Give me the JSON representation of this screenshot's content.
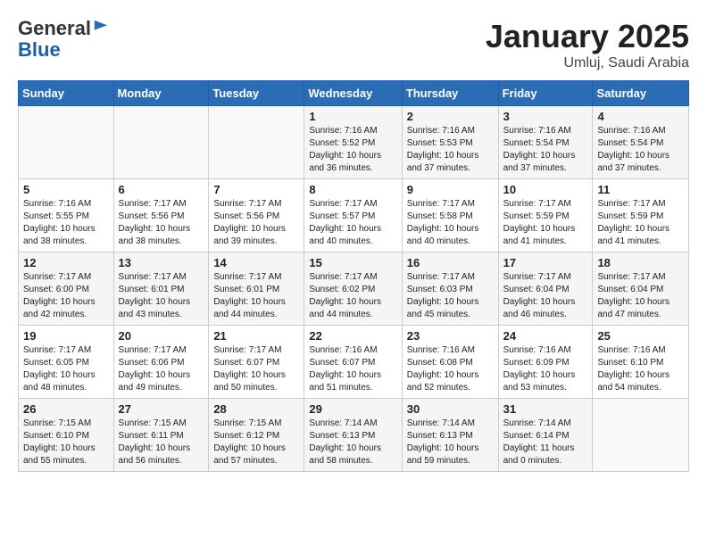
{
  "header": {
    "logo_line1": "General",
    "logo_line2": "Blue",
    "month": "January 2025",
    "location": "Umluj, Saudi Arabia"
  },
  "days_of_week": [
    "Sunday",
    "Monday",
    "Tuesday",
    "Wednesday",
    "Thursday",
    "Friday",
    "Saturday"
  ],
  "weeks": [
    [
      {
        "num": "",
        "info": ""
      },
      {
        "num": "",
        "info": ""
      },
      {
        "num": "",
        "info": ""
      },
      {
        "num": "1",
        "info": "Sunrise: 7:16 AM\nSunset: 5:52 PM\nDaylight: 10 hours and 36 minutes."
      },
      {
        "num": "2",
        "info": "Sunrise: 7:16 AM\nSunset: 5:53 PM\nDaylight: 10 hours and 37 minutes."
      },
      {
        "num": "3",
        "info": "Sunrise: 7:16 AM\nSunset: 5:54 PM\nDaylight: 10 hours and 37 minutes."
      },
      {
        "num": "4",
        "info": "Sunrise: 7:16 AM\nSunset: 5:54 PM\nDaylight: 10 hours and 37 minutes."
      }
    ],
    [
      {
        "num": "5",
        "info": "Sunrise: 7:16 AM\nSunset: 5:55 PM\nDaylight: 10 hours and 38 minutes."
      },
      {
        "num": "6",
        "info": "Sunrise: 7:17 AM\nSunset: 5:56 PM\nDaylight: 10 hours and 38 minutes."
      },
      {
        "num": "7",
        "info": "Sunrise: 7:17 AM\nSunset: 5:56 PM\nDaylight: 10 hours and 39 minutes."
      },
      {
        "num": "8",
        "info": "Sunrise: 7:17 AM\nSunset: 5:57 PM\nDaylight: 10 hours and 40 minutes."
      },
      {
        "num": "9",
        "info": "Sunrise: 7:17 AM\nSunset: 5:58 PM\nDaylight: 10 hours and 40 minutes."
      },
      {
        "num": "10",
        "info": "Sunrise: 7:17 AM\nSunset: 5:59 PM\nDaylight: 10 hours and 41 minutes."
      },
      {
        "num": "11",
        "info": "Sunrise: 7:17 AM\nSunset: 5:59 PM\nDaylight: 10 hours and 41 minutes."
      }
    ],
    [
      {
        "num": "12",
        "info": "Sunrise: 7:17 AM\nSunset: 6:00 PM\nDaylight: 10 hours and 42 minutes."
      },
      {
        "num": "13",
        "info": "Sunrise: 7:17 AM\nSunset: 6:01 PM\nDaylight: 10 hours and 43 minutes."
      },
      {
        "num": "14",
        "info": "Sunrise: 7:17 AM\nSunset: 6:01 PM\nDaylight: 10 hours and 44 minutes."
      },
      {
        "num": "15",
        "info": "Sunrise: 7:17 AM\nSunset: 6:02 PM\nDaylight: 10 hours and 44 minutes."
      },
      {
        "num": "16",
        "info": "Sunrise: 7:17 AM\nSunset: 6:03 PM\nDaylight: 10 hours and 45 minutes."
      },
      {
        "num": "17",
        "info": "Sunrise: 7:17 AM\nSunset: 6:04 PM\nDaylight: 10 hours and 46 minutes."
      },
      {
        "num": "18",
        "info": "Sunrise: 7:17 AM\nSunset: 6:04 PM\nDaylight: 10 hours and 47 minutes."
      }
    ],
    [
      {
        "num": "19",
        "info": "Sunrise: 7:17 AM\nSunset: 6:05 PM\nDaylight: 10 hours and 48 minutes."
      },
      {
        "num": "20",
        "info": "Sunrise: 7:17 AM\nSunset: 6:06 PM\nDaylight: 10 hours and 49 minutes."
      },
      {
        "num": "21",
        "info": "Sunrise: 7:17 AM\nSunset: 6:07 PM\nDaylight: 10 hours and 50 minutes."
      },
      {
        "num": "22",
        "info": "Sunrise: 7:16 AM\nSunset: 6:07 PM\nDaylight: 10 hours and 51 minutes."
      },
      {
        "num": "23",
        "info": "Sunrise: 7:16 AM\nSunset: 6:08 PM\nDaylight: 10 hours and 52 minutes."
      },
      {
        "num": "24",
        "info": "Sunrise: 7:16 AM\nSunset: 6:09 PM\nDaylight: 10 hours and 53 minutes."
      },
      {
        "num": "25",
        "info": "Sunrise: 7:16 AM\nSunset: 6:10 PM\nDaylight: 10 hours and 54 minutes."
      }
    ],
    [
      {
        "num": "26",
        "info": "Sunrise: 7:15 AM\nSunset: 6:10 PM\nDaylight: 10 hours and 55 minutes."
      },
      {
        "num": "27",
        "info": "Sunrise: 7:15 AM\nSunset: 6:11 PM\nDaylight: 10 hours and 56 minutes."
      },
      {
        "num": "28",
        "info": "Sunrise: 7:15 AM\nSunset: 6:12 PM\nDaylight: 10 hours and 57 minutes."
      },
      {
        "num": "29",
        "info": "Sunrise: 7:14 AM\nSunset: 6:13 PM\nDaylight: 10 hours and 58 minutes."
      },
      {
        "num": "30",
        "info": "Sunrise: 7:14 AM\nSunset: 6:13 PM\nDaylight: 10 hours and 59 minutes."
      },
      {
        "num": "31",
        "info": "Sunrise: 7:14 AM\nSunset: 6:14 PM\nDaylight: 11 hours and 0 minutes."
      },
      {
        "num": "",
        "info": ""
      }
    ]
  ]
}
